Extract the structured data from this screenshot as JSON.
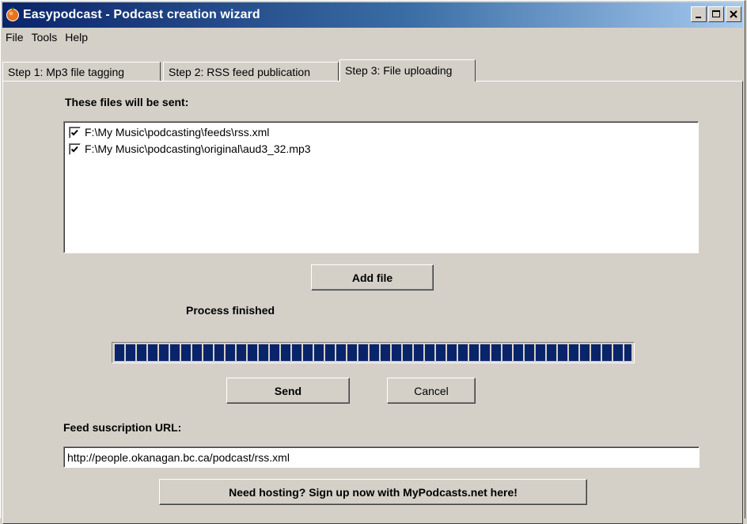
{
  "window": {
    "title": "Easypodcast - Podcast creation wizard"
  },
  "menu": [
    "File",
    "Tools",
    "Help"
  ],
  "tabs": [
    {
      "label": "Step 1: Mp3 file tagging",
      "active": false
    },
    {
      "label": "Step 2: RSS feed publication",
      "active": false
    },
    {
      "label": "Step 3: File uploading",
      "active": true
    }
  ],
  "files": {
    "heading": "These files will be sent:",
    "items": [
      {
        "path": "F:\\My Music\\podcasting\\feeds\\rss.xml",
        "checked": true
      },
      {
        "path": "F:\\My Music\\podcasting\\original\\aud3_32.mp3",
        "checked": true
      }
    ],
    "add_label": "Add file"
  },
  "process": {
    "status": "Process finished",
    "progress": 1.0
  },
  "actions": {
    "send_label": "Send",
    "cancel_label": "Cancel"
  },
  "feed": {
    "label": "Feed suscription URL:",
    "url": "http://people.okanagan.bc.ca/podcast/rss.xml"
  },
  "hosting": {
    "label": "Need hosting? Sign up now with MyPodcasts.net here!"
  },
  "colors": {
    "title_start": "#0a246a",
    "title_end": "#a6caf0",
    "progress": "#0a246a",
    "face": "#d4d0c8"
  }
}
